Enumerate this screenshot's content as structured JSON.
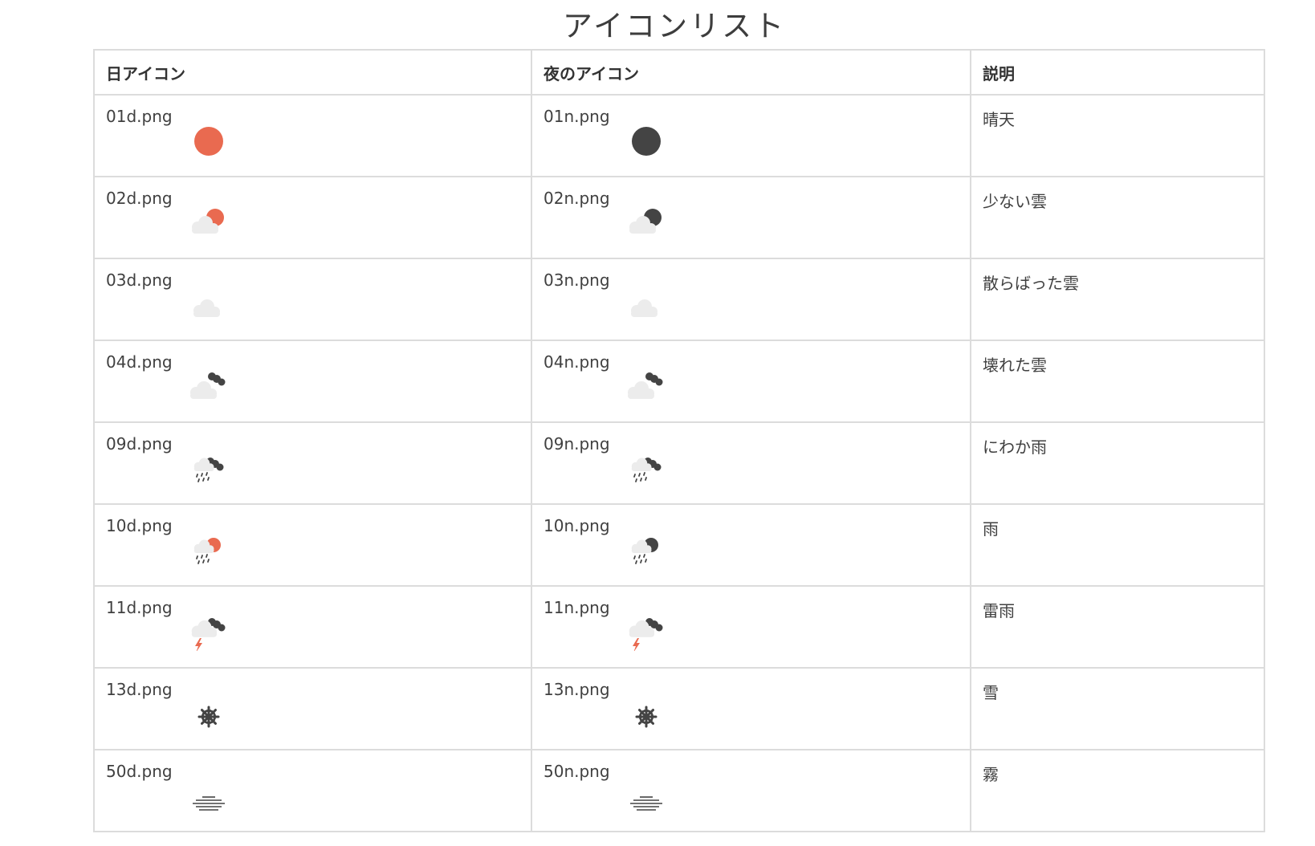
{
  "title": "アイコンリスト",
  "headers": {
    "day": "日アイコン",
    "night": "夜のアイコン",
    "description": "説明"
  },
  "colors": {
    "sun": "#e96a50",
    "dark": "#444444",
    "cloud": "#ececec"
  },
  "rows": [
    {
      "day_file": "01d.png",
      "night_file": "01n.png",
      "description": "晴天",
      "day_icon": "sun-icon",
      "night_icon": "moon-icon"
    },
    {
      "day_file": "02d.png",
      "night_file": "02n.png",
      "description": "少ない雲",
      "day_icon": "few-clouds-day-icon",
      "night_icon": "few-clouds-night-icon"
    },
    {
      "day_file": "03d.png",
      "night_file": "03n.png",
      "description": "散らばった雲",
      "day_icon": "cloud-icon",
      "night_icon": "cloud-icon"
    },
    {
      "day_file": "04d.png",
      "night_file": "04n.png",
      "description": "壊れた雲",
      "day_icon": "broken-clouds-icon",
      "night_icon": "broken-clouds-icon"
    },
    {
      "day_file": "09d.png",
      "night_file": "09n.png",
      "description": "にわか雨",
      "day_icon": "shower-rain-icon",
      "night_icon": "shower-rain-icon"
    },
    {
      "day_file": "10d.png",
      "night_file": "10n.png",
      "description": "雨",
      "day_icon": "rain-day-icon",
      "night_icon": "rain-night-icon"
    },
    {
      "day_file": "11d.png",
      "night_file": "11n.png",
      "description": "雷雨",
      "day_icon": "thunderstorm-icon",
      "night_icon": "thunderstorm-icon"
    },
    {
      "day_file": "13d.png",
      "night_file": "13n.png",
      "description": "雪",
      "day_icon": "snowflake-icon",
      "night_icon": "snowflake-icon"
    },
    {
      "day_file": "50d.png",
      "night_file": "50n.png",
      "description": "霧",
      "day_icon": "mist-icon",
      "night_icon": "mist-icon"
    }
  ]
}
